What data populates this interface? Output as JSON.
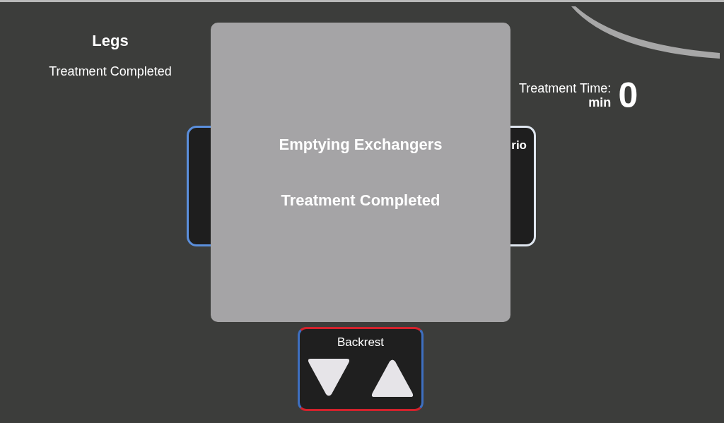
{
  "header": {
    "zone": "Legs",
    "status": "Treatment Completed"
  },
  "treatment_time": {
    "label": "Treatment Time:",
    "unit": "min",
    "value": "0"
  },
  "right_card": {
    "label": "rio"
  },
  "dialog": {
    "lines": [
      "Emptying Exchangers",
      "Treatment Completed"
    ]
  },
  "backrest": {
    "label": "Backrest"
  }
}
